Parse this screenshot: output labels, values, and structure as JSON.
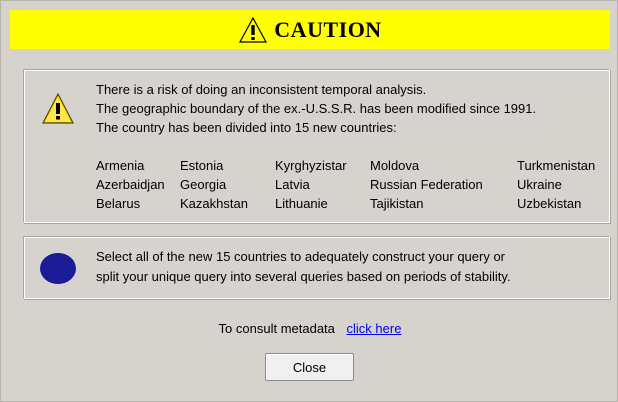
{
  "title": {
    "text": "CAUTION",
    "icon": "warning-icon",
    "background": "#ffff00"
  },
  "warning": {
    "icon": "warning-icon",
    "lines": [
      "There is a risk of doing an inconsistent temporal analysis.",
      "The geographic boundary of the ex.-U.S.S.R. has been modified since 1991.",
      "The country has been divided into 15 new countries:"
    ],
    "countries": [
      [
        "Armenia",
        "Estonia",
        "Kyrghyzistar",
        "Moldova",
        "Turkmenistan"
      ],
      [
        "Azerbaidjan",
        "Georgia",
        "Latvia",
        "Russian Federation",
        "Ukraine"
      ],
      [
        "Belarus",
        "Kazakhstan",
        "Lithuanie",
        "Tajikistan",
        "Uzbekistan"
      ]
    ]
  },
  "info": {
    "icon": "blue-circle-icon",
    "icon_color": "#1b1b96",
    "lines": [
      "Select all of the new 15 countries to adequately construct your query or",
      "split your unique query into several queries based on periods of stability."
    ]
  },
  "metadata": {
    "prefix": "To consult metadata",
    "link_text": "click here"
  },
  "close_button": {
    "label": "Close"
  }
}
